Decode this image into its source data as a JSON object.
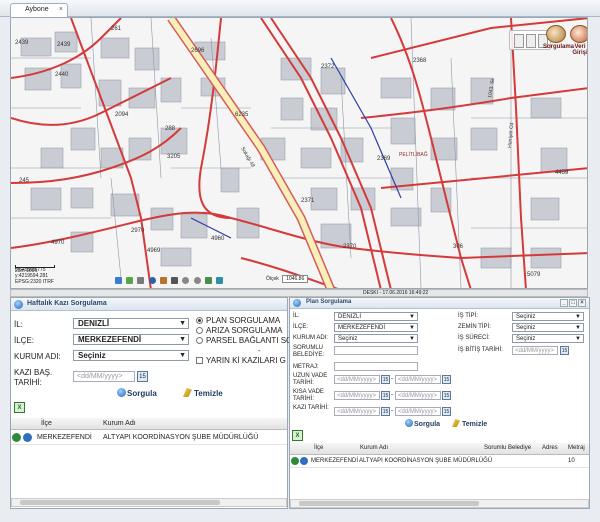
{
  "tab": {
    "label": "Aybone",
    "close": "×"
  },
  "map": {
    "parcel_labels": [
      "2439",
      "261",
      "2696",
      "2439",
      "2440",
      "2372",
      "2368",
      "2094",
      "6235",
      "288",
      "3205",
      "2369",
      "245",
      "4459",
      "2371",
      "4970",
      "2970",
      "4960",
      "4969",
      "306",
      "5079",
      "2370"
    ],
    "street_labels": [
      "Sokağı 48",
      "1043. Sk",
      "Hürriyet Cd",
      "PELİTLİBAĞ"
    ],
    "scale": {
      "label1": "25m",
      "label2": "100ft"
    },
    "coordinates": [
      "0.545568.775",
      "y:4219594.281",
      "EPSG:2320 ITRF"
    ],
    "olcek_label": "Ölçek",
    "olcek_value": "1046.86",
    "tools": {
      "sorgulama_label": "Sorgulama",
      "veri_girisi_label": "Veri Girişi"
    }
  },
  "status": {
    "text": "DESKI - 17.06.2016 16:49:22"
  },
  "left_panel": {
    "title": "Haftalık Kazı Sorgulama",
    "il_label": "İL:",
    "il_value": "DENIZLİ",
    "ilce_label": "İLÇE:",
    "ilce_value": "MERKEZEFENDİ",
    "kurum_label": "KURUM ADI:",
    "kurum_value": "Seçiniz",
    "kazi_label": "KAZI BAŞ. TARİHİ:",
    "kazi_placeholder": "<dd/MM/yyyy>",
    "cal_label": "15",
    "radio_plan": "PLAN SORGULAMA",
    "radio_ariza": "ARIZA SORGULAMA",
    "radio_parsel": "PARSEL BAĞLANTI SO",
    "dash": "-",
    "check_yarin": "YARIN Kİ KAZILARI G",
    "sorgula_label": "Sorgula",
    "temizle_label": "Temizle",
    "excel_label": "X",
    "grid": {
      "col_ilce": "İlçe",
      "col_kurum": "Kurum Adı",
      "rows": [
        {
          "ilce": "MERKEZEFENDİ",
          "kurum": "ALTYAPI KOORDİNASYON ŞUBE MÜDÜRLÜĞÜ"
        }
      ]
    }
  },
  "right_panel": {
    "title": "Plan Sorgulama",
    "win_buttons": [
      "_",
      "□",
      "×"
    ],
    "il_label": "İL:",
    "il_value": "DENIZLİ",
    "ilce_label": "İLÇE:",
    "ilce_value": "MERKEZEFENDİ",
    "kurum_label": "KURUM ADI:",
    "kurum_value": "Seçiniz",
    "sorumlu_label": "SORUMLU BELEDİYE:",
    "metraj_label": "METRAJ:",
    "uzun_label": "UZUN VADE TARİHİ:",
    "kisa_label": "KISA VADE TARİHİ:",
    "kazi_label": "KAZI TARİHİ:",
    "date_placeholder": "<dd/MM/yyyy>",
    "cal_label": "15",
    "is_tipi_label": "İŞ TİPİ:",
    "is_tipi_value": "Seçiniz",
    "zemin_label": "ZEMİN TİPİ:",
    "zemin_value": "Seçiniz",
    "is_sureci_label": "İŞ SÜRECİ:",
    "is_sureci_value": "Seçiniz",
    "is_bitis_label": "İŞ BİTİŞ TARİHİ:",
    "sorgula_label": "Sorgula",
    "temizle_label": "Temizle",
    "excel_label": "X",
    "grid": {
      "col_ilce": "İlçe",
      "col_kurum": "Kurum Adı",
      "col_belediye": "Sorumlu Belediye",
      "col_adres": "Adres",
      "col_metraj": "Metraj",
      "rows": [
        {
          "ilce": "MERKEZEFENDİ",
          "kurum": "ALTYAPI KOORDİNASYON ŞUBE MÜDÜRLÜĞÜ",
          "belediye": "",
          "adres": "",
          "metraj": "10"
        }
      ]
    }
  }
}
